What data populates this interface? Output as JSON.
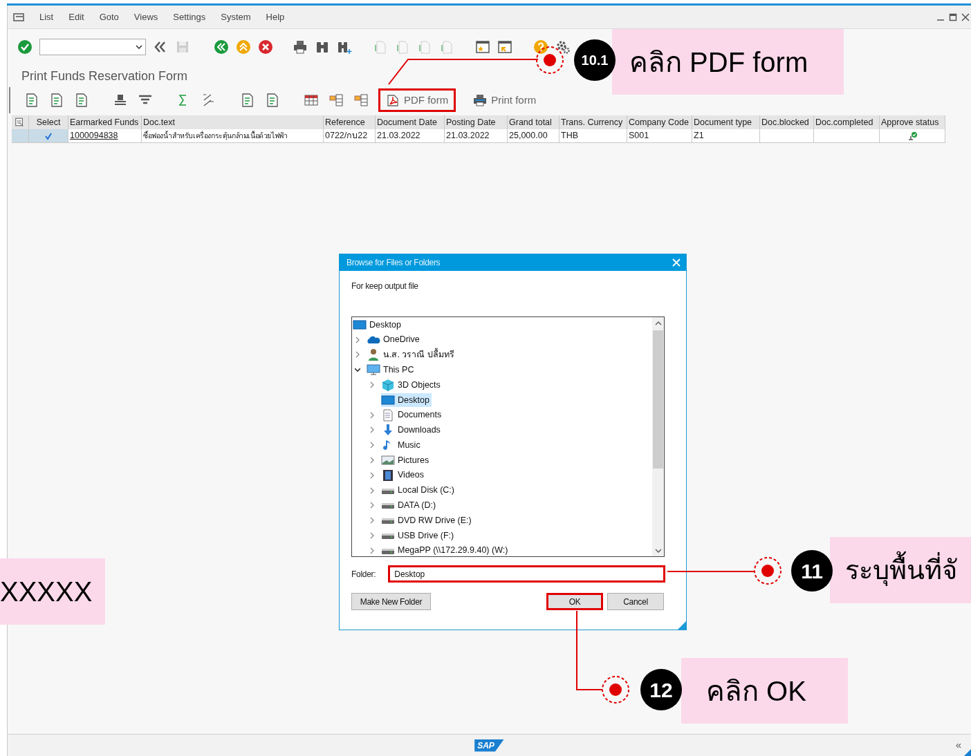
{
  "menu_bar": [
    "List",
    "Edit",
    "Goto",
    "Views",
    "Settings",
    "System",
    "Help"
  ],
  "screen_title": "Print Funds Reservation Form",
  "app_toolbar": [
    {
      "label": "PDF form",
      "kind": "pdf",
      "highlighted": true
    },
    {
      "label": "Print form",
      "kind": "print",
      "highlighted": false
    }
  ],
  "table": {
    "columns": [
      "Select",
      "Earmarked Funds",
      "Doc.text",
      "Reference",
      "Document Date",
      "Posting Date",
      "Grand total",
      "Trans. Currency",
      "Company Code",
      "Document type",
      "Doc.blocked",
      "Doc.completed",
      "Approve status"
    ],
    "rows": [
      {
        "checked": true,
        "earmarked_funds": "1000094838",
        "doc_text": "ซื้อฟองน้ำสำหรับเครื่องกระตุ้นกล้ามเนื้อด้วยไฟฟ้า",
        "reference": "0722/กบ22",
        "document_date": "21.03.2022",
        "posting_date": "21.03.2022",
        "grand_total": "25,000.00",
        "currency": "THB",
        "company_code": "S001",
        "document_type": "Z1",
        "approved": true
      }
    ]
  },
  "dialog": {
    "title": "Browse for Files or Folders",
    "prompt": "For keep output file",
    "tree": [
      {
        "label": "Desktop",
        "kind": "desktop",
        "selected": false,
        "children": [
          {
            "label": "OneDrive",
            "kind": "cloud",
            "selected": false,
            "expanded": false
          },
          {
            "label": "น.ส. วราณี ปลื้มทรี",
            "kind": "user",
            "selected": false,
            "expanded": false
          },
          {
            "label": "This PC",
            "kind": "pc",
            "selected": false,
            "expanded": true,
            "children": [
              {
                "label": "3D Objects",
                "kind": "cube",
                "selected": false,
                "expanded": false
              },
              {
                "label": "Desktop",
                "kind": "desktop",
                "selected": true
              },
              {
                "label": "Documents",
                "kind": "document",
                "selected": false,
                "expanded": false
              },
              {
                "label": "Downloads",
                "kind": "download",
                "selected": false,
                "expanded": false
              },
              {
                "label": "Music",
                "kind": "music",
                "selected": false,
                "expanded": false
              },
              {
                "label": "Pictures",
                "kind": "picture",
                "selected": false,
                "expanded": false
              },
              {
                "label": "Videos",
                "kind": "video",
                "selected": false,
                "expanded": false
              },
              {
                "label": "Local Disk (C:)",
                "kind": "drive",
                "selected": false,
                "expanded": false
              },
              {
                "label": "DATA (D:)",
                "kind": "drive",
                "selected": false,
                "expanded": false
              },
              {
                "label": "DVD RW Drive (E:)",
                "kind": "drive",
                "selected": false,
                "expanded": false
              },
              {
                "label": "USB Drive (F:)",
                "kind": "drive",
                "selected": false,
                "expanded": false
              },
              {
                "label": "MegaPP (\\\\172.29.9.40) (W:)",
                "kind": "drive",
                "selected": false,
                "expanded": false
              }
            ]
          }
        ]
      }
    ],
    "folder_label": "Folder:",
    "folder_value": "Desktop",
    "folder_highlighted": true,
    "buttons": [
      {
        "label": "Make New Folder",
        "highlighted": false
      },
      {
        "label": "OK",
        "highlighted": true
      },
      {
        "label": "Cancel",
        "highlighted": false
      }
    ]
  },
  "annotations": [
    {
      "kind": "step",
      "number": "10.1",
      "text": "คลิก PDF form"
    },
    {
      "kind": "step",
      "number": "11",
      "text": "ระบุพื้นที่จั"
    },
    {
      "kind": "step",
      "number": "12",
      "text": "คลิก OK"
    },
    {
      "kind": "note",
      "text": "XXXXX"
    }
  ],
  "status_bar": {
    "logo": "SAP",
    "collapse": "«"
  }
}
